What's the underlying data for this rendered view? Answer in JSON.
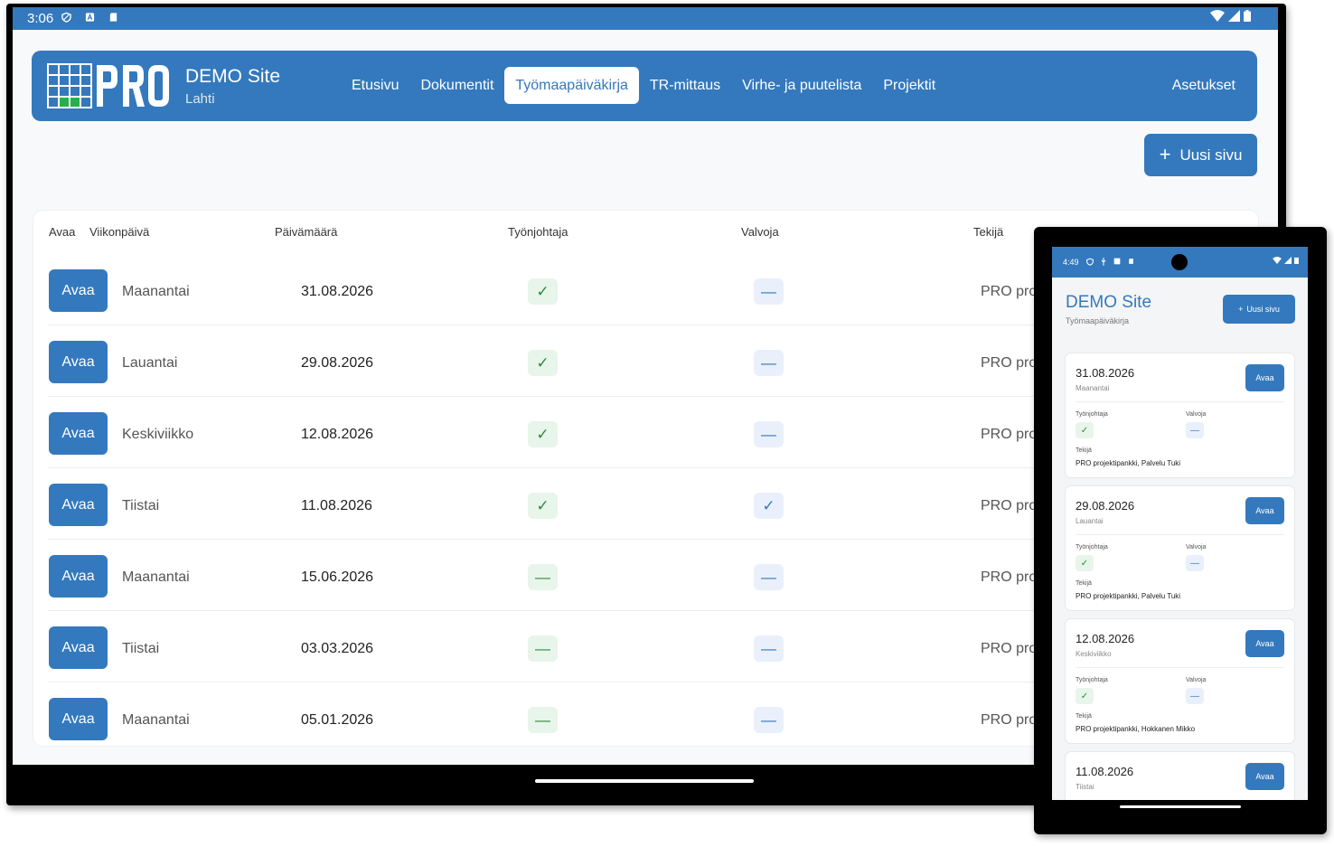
{
  "tablet": {
    "status": {
      "time": "3:06"
    },
    "header": {
      "site_title": "DEMO Site",
      "site_subtitle": "Lahti",
      "nav": [
        "Etusivu",
        "Dokumentit",
        "Työmaapäiväkirja",
        "TR-mittaus",
        "Virhe- ja puutelista",
        "Projektit"
      ],
      "active_nav": "Työmaapäiväkirja",
      "settings": "Asetukset"
    },
    "new_page_button": "Uusi sivu",
    "table": {
      "columns": [
        "Avaa",
        "Viikonpäivä",
        "Päivämäärä",
        "Työnjohtaja",
        "Valvoja",
        "Tekijä"
      ],
      "open_label": "Avaa",
      "rows": [
        {
          "day": "Maanantai",
          "date": "31.08.2026",
          "supervisor": "✓",
          "inspector": "—",
          "maker": "PRO pro"
        },
        {
          "day": "Lauantai",
          "date": "29.08.2026",
          "supervisor": "✓",
          "inspector": "—",
          "maker": "PRO pro"
        },
        {
          "day": "Keskiviikko",
          "date": "12.08.2026",
          "supervisor": "✓",
          "inspector": "—",
          "maker": "PRO pro"
        },
        {
          "day": "Tiistai",
          "date": "11.08.2026",
          "supervisor": "✓",
          "inspector": "✓",
          "maker": "PRO pro"
        },
        {
          "day": "Maanantai",
          "date": "15.06.2026",
          "supervisor": "—",
          "inspector": "—",
          "maker": "PRO pro"
        },
        {
          "day": "Tiistai",
          "date": "03.03.2026",
          "supervisor": "—",
          "inspector": "—",
          "maker": "PRO pro"
        },
        {
          "day": "Maanantai",
          "date": "05.01.2026",
          "supervisor": "—",
          "inspector": "—",
          "maker": "PRO pro"
        }
      ]
    }
  },
  "phone": {
    "status": {
      "time": "4:49"
    },
    "site_title": "DEMO Site",
    "subtitle": "Työmaapäiväkirja",
    "new_page_button": "Uusi sivu",
    "labels": {
      "open": "Avaa",
      "supervisor": "Työnjohtaja",
      "inspector": "Valvoja",
      "maker": "Tekijä"
    },
    "cards": [
      {
        "date": "31.08.2026",
        "day": "Maanantai",
        "supervisor": "✓",
        "inspector": "—",
        "maker": "PRO projektipankki, Palvelu Tuki"
      },
      {
        "date": "29.08.2026",
        "day": "Lauantai",
        "supervisor": "✓",
        "inspector": "—",
        "maker": "PRO projektipankki, Palvelu Tuki"
      },
      {
        "date": "12.08.2026",
        "day": "Keskiviikko",
        "supervisor": "✓",
        "inspector": "—",
        "maker": "PRO projektipankki, Hokkanen Mikko"
      },
      {
        "date": "11.08.2026",
        "day": "Tiistai",
        "supervisor": "",
        "inspector": "",
        "maker": ""
      }
    ]
  },
  "colors": {
    "brand": "#3479bd",
    "check_green": "#2e8a3d",
    "chip_green_bg": "#e8f5ea",
    "chip_blue_bg": "#e9f0fb"
  }
}
